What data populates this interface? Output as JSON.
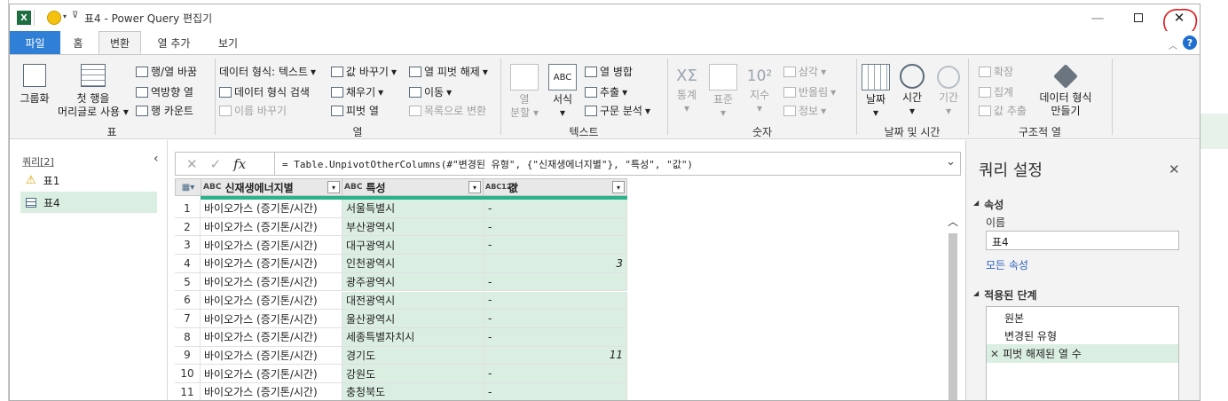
{
  "window": {
    "title": "표4 - Power Query 편집기",
    "minimize": "—",
    "maximize": "☐",
    "close": "✕"
  },
  "tabs": [
    "파일",
    "홈",
    "변환",
    "열 추가",
    "보기"
  ],
  "ribbon": {
    "table": {
      "group_btn": "그룹화",
      "first_row_1": "첫 행을",
      "first_row_2": "머리글로 사용",
      "transpose": "행/열 바꿈",
      "reverse": "역방향 열",
      "count_rows": "행 카운트",
      "label": "표"
    },
    "column": {
      "data_type": "데이터 형식: 텍스트",
      "detect_type": "데이터 형식 검색",
      "rename": "이름 바꾸기",
      "replace_values": "값 바꾸기",
      "fill": "채우기",
      "pivot": "피벗 열",
      "unpivot": "열 피벗 해제",
      "move": "이동",
      "to_list": "목록으로 변환",
      "label": "열"
    },
    "text": {
      "split_1": "열",
      "split_2": "분할",
      "format": "서식",
      "merge": "열 병합",
      "extract": "추출",
      "parse": "구문 분석",
      "label": "텍스트"
    },
    "number": {
      "statistics": "통계",
      "standard": "표준",
      "scientific": "지수",
      "trig": "삼각",
      "rounding": "반올림",
      "info": "정보",
      "label": "숫자"
    },
    "datetime": {
      "date": "날짜",
      "time": "시간",
      "duration": "기간",
      "label": "날짜 및 시간"
    },
    "structured": {
      "expand": "확장",
      "aggregate": "집계",
      "extract_values": "값 추출",
      "create_type_1": "데이터 형식",
      "create_type_2": "만들기",
      "label": "구조적 열"
    }
  },
  "queries": {
    "header": "쿼리[2]",
    "items": [
      "표1",
      "표4"
    ]
  },
  "formula": {
    "fx": "fx",
    "text": "= Table.UnpivotOtherColumns(#\"변경된 유형\", {\"신재생에너지별\"}, \"특성\", \"값\")"
  },
  "grid": {
    "columns": [
      {
        "type": "ABC",
        "name": "신재생에너지별"
      },
      {
        "type": "ABC",
        "name": "특성"
      },
      {
        "type": "ABC123",
        "name": "값"
      }
    ],
    "rows": [
      {
        "n": "1",
        "a": "바이오가스 (증기톤/시간)",
        "b": "서울특별시",
        "c": "-"
      },
      {
        "n": "2",
        "a": "바이오가스 (증기톤/시간)",
        "b": "부산광역시",
        "c": "-"
      },
      {
        "n": "3",
        "a": "바이오가스 (증기톤/시간)",
        "b": "대구광역시",
        "c": "-"
      },
      {
        "n": "4",
        "a": "바이오가스 (증기톤/시간)",
        "b": "인천광역시",
        "c": "3"
      },
      {
        "n": "5",
        "a": "바이오가스 (증기톤/시간)",
        "b": "광주광역시",
        "c": "-"
      },
      {
        "n": "6",
        "a": "바이오가스 (증기톤/시간)",
        "b": "대전광역시",
        "c": "-"
      },
      {
        "n": "7",
        "a": "바이오가스 (증기톤/시간)",
        "b": "울산광역시",
        "c": "-"
      },
      {
        "n": "8",
        "a": "바이오가스 (증기톤/시간)",
        "b": "세종특별자치시",
        "c": "-"
      },
      {
        "n": "9",
        "a": "바이오가스 (증기톤/시간)",
        "b": "경기도",
        "c": "11"
      },
      {
        "n": "10",
        "a": "바이오가스 (증기톤/시간)",
        "b": "강원도",
        "c": "-"
      },
      {
        "n": "11",
        "a": "바이오가스 (증기톤/시간)",
        "b": "충청북도",
        "c": "-"
      }
    ]
  },
  "settings": {
    "title": "쿼리 설정",
    "properties": "속성",
    "name_label": "이름",
    "name_value": "표4",
    "all_properties": "모든 속성",
    "applied_steps": "적용된 단계",
    "steps": [
      "원본",
      "변경된 유형",
      "피벗 해제된 열 수"
    ]
  },
  "colors": {
    "file_tab": "#2f7fd6",
    "selection": "#dbeee2",
    "annotation": "#e0191e"
  }
}
